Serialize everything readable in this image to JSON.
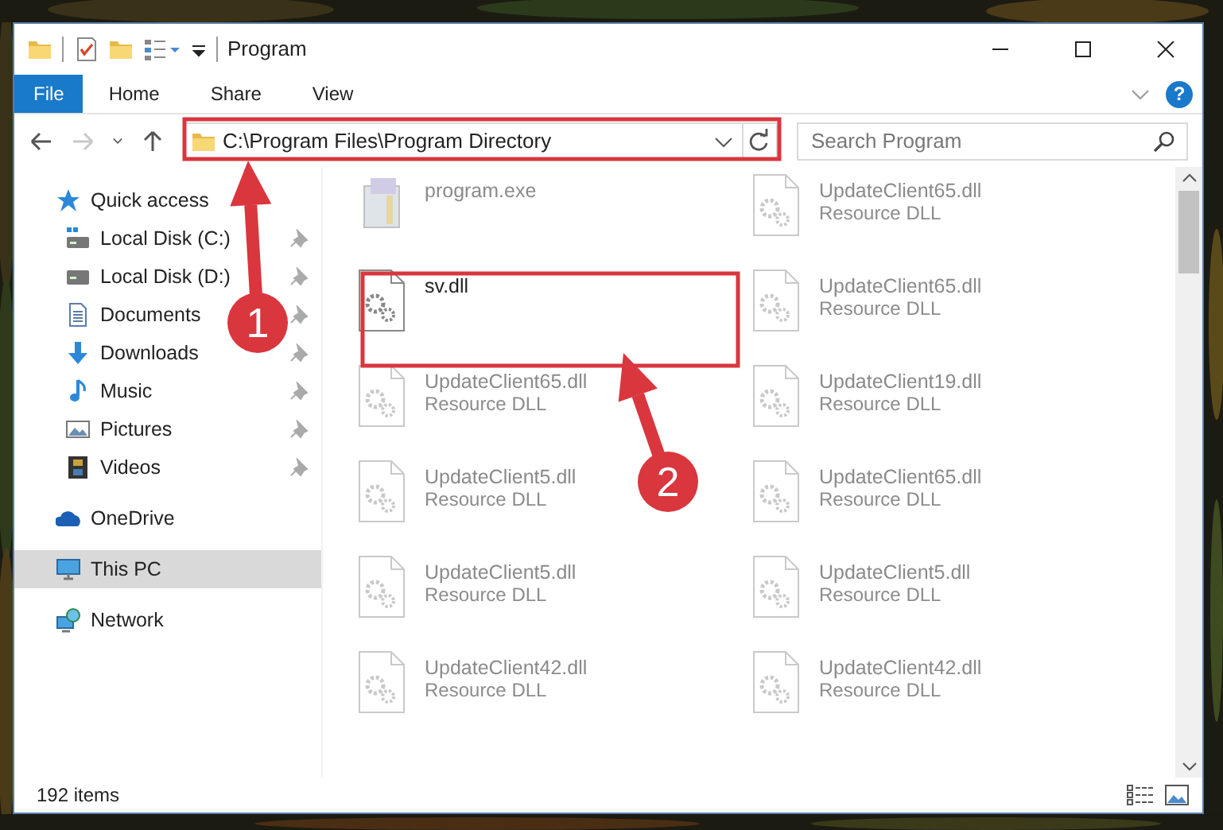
{
  "window": {
    "title": "Program"
  },
  "ribbon": {
    "tabs": [
      {
        "label": "File",
        "kind": "file"
      },
      {
        "label": "Home",
        "kind": "tab"
      },
      {
        "label": "Share",
        "kind": "tab"
      },
      {
        "label": "View",
        "kind": "tab"
      }
    ],
    "help": "?"
  },
  "navigation": {
    "buttons": [
      {
        "kind": "back",
        "disabled": false
      },
      {
        "kind": "forward",
        "disabled": true
      },
      {
        "kind": "recent",
        "disabled": false
      },
      {
        "kind": "up",
        "disabled": false
      }
    ],
    "address": "C:\\Program Files\\Program Directory",
    "search": {
      "placeholder": "Search Program"
    }
  },
  "sidebar": {
    "items": [
      {
        "label": "Quick access",
        "kind": "quick-access",
        "selected": false,
        "children": [
          {
            "label": "Local Disk (C:)",
            "kind": "system-drive",
            "pinned": true,
            "selected": false
          },
          {
            "label": "Local Disk (D:)",
            "kind": "drive",
            "pinned": true,
            "selected": false
          },
          {
            "label": "Documents",
            "kind": "documents",
            "pinned": true,
            "selected": false
          },
          {
            "label": "Downloads",
            "kind": "downloads",
            "pinned": true,
            "selected": false
          },
          {
            "label": "Music",
            "kind": "music",
            "pinned": true,
            "selected": false
          },
          {
            "label": "Pictures",
            "kind": "pictures",
            "pinned": true,
            "selected": false
          },
          {
            "label": "Videos",
            "kind": "videos",
            "pinned": true,
            "selected": false
          }
        ]
      },
      {
        "label": "OneDrive",
        "kind": "onedrive",
        "selected": false
      },
      {
        "label": "This PC",
        "kind": "pc",
        "selected": true
      },
      {
        "label": "Network",
        "kind": "network",
        "selected": false
      }
    ]
  },
  "files": [
    {
      "name": "program.exe",
      "kind": "exe",
      "blurred": true
    },
    {
      "name": "UpdateClient65.dll",
      "type": "Resource DLL",
      "kind": "dll",
      "blurred": true
    },
    {
      "name": "sv.dll",
      "kind": "dll",
      "blurred": false
    },
    {
      "name": "UpdateClient65.dll",
      "type": "Resource DLL",
      "kind": "dll",
      "blurred": true
    },
    {
      "name": "UpdateClient65.dll",
      "type": "Resource DLL",
      "kind": "dll",
      "blurred": true
    },
    {
      "name": "UpdateClient19.dll",
      "type": "Resource DLL",
      "kind": "dll",
      "blurred": true
    },
    {
      "name": "UpdateClient5.dll",
      "type": "Resource DLL",
      "kind": "dll",
      "blurred": true
    },
    {
      "name": "UpdateClient65.dll",
      "type": "Resource DLL",
      "kind": "dll",
      "blurred": true
    },
    {
      "name": "UpdateClient5.dll",
      "type": "Resource DLL",
      "kind": "dll",
      "blurred": true
    },
    {
      "name": "UpdateClient5.dll",
      "type": "Resource DLL",
      "kind": "dll",
      "blurred": true
    },
    {
      "name": "UpdateClient42.dll",
      "type": "Resource DLL",
      "kind": "dll",
      "blurred": true
    },
    {
      "name": "UpdateClient42.dll",
      "type": "Resource DLL",
      "kind": "dll",
      "blurred": true
    }
  ],
  "status_bar": {
    "count": "192 items"
  },
  "annotations": [
    {
      "number": "1"
    },
    {
      "number": "2"
    }
  ]
}
